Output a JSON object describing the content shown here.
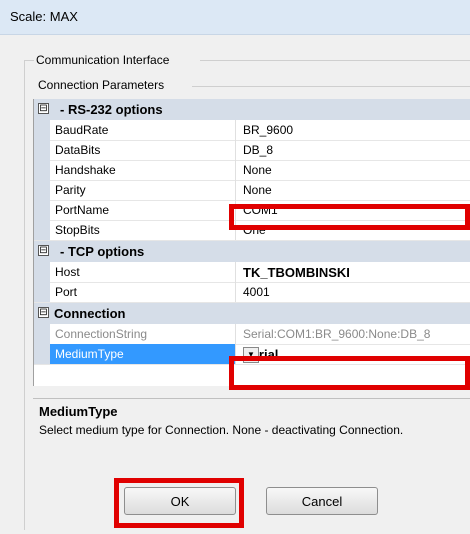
{
  "window": {
    "title": "Scale: MAX"
  },
  "groups": {
    "communication": "Communication Interface",
    "connection": "Connection Parameters"
  },
  "grid": {
    "categories": [
      {
        "toggle": "⊟",
        "label": "- RS-232 options",
        "rows": [
          {
            "name": "BaudRate",
            "value": "BR_9600"
          },
          {
            "name": "DataBits",
            "value": "DB_8"
          },
          {
            "name": "Handshake",
            "value": "None"
          },
          {
            "name": "Parity",
            "value": "None"
          },
          {
            "name": "PortName",
            "value": "COM1"
          },
          {
            "name": "StopBits",
            "value": "One"
          }
        ]
      },
      {
        "toggle": "⊟",
        "label": "- TCP options",
        "rows": [
          {
            "name": "Host",
            "value": "TK_TBOMBINSKI"
          },
          {
            "name": "Port",
            "value": "4001"
          }
        ]
      },
      {
        "toggle": "⊟",
        "label": "Connection",
        "rows": [
          {
            "name": "ConnectionString",
            "value": "Serial:COM1:BR_9600:None:DB_8"
          },
          {
            "name": "MediumType",
            "value": "Serial"
          }
        ]
      }
    ]
  },
  "help": {
    "title": "MediumType",
    "text": "Select medium type for Connection. None - deactivating Connection."
  },
  "buttons": {
    "ok": "OK",
    "cancel": "Cancel"
  },
  "icons": {
    "dropdown": "chevron-down-icon",
    "collapse": "collapse-toggle-icon"
  },
  "colors": {
    "highlight": "#e00000",
    "selection": "#3399ff",
    "category_bg": "#d5dde8"
  }
}
